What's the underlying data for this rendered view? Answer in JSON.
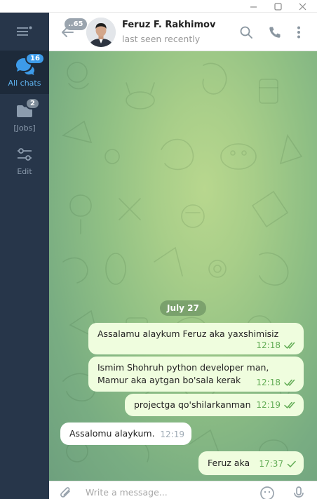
{
  "window": {
    "controls": [
      {
        "name": "minimize-button",
        "icon": "minimize-icon"
      },
      {
        "name": "maximize-button",
        "icon": "maximize-icon"
      },
      {
        "name": "close-button",
        "icon": "close-icon"
      }
    ]
  },
  "sidebar": {
    "menu_icon": "hamburger-menu-icon",
    "folders": [
      {
        "label": "All chats",
        "badge": "16",
        "icon": "chats-icon",
        "active": true
      },
      {
        "label": "[Jobs]",
        "badge": "2",
        "icon": "folder-icon",
        "active": false
      },
      {
        "label": "Edit",
        "icon": "sliders-icon",
        "active": false
      }
    ]
  },
  "header": {
    "back_badge": "..65",
    "name": "Feruz F. Rakhimov",
    "status": "last seen recently",
    "icons": [
      "search-icon",
      "phone-icon",
      "more-vertical-icon"
    ]
  },
  "chat": {
    "date_separator": "July 27",
    "messages": [
      {
        "direction": "out",
        "text": "Assalamu alaykum Feruz aka yaxshimisiz",
        "time": "12:18",
        "status": "read"
      },
      {
        "direction": "out",
        "text": "Ismim Shohruh python developer man,\nMamur aka aytgan bo'sala kerak",
        "time": "12:18",
        "status": "read"
      },
      {
        "direction": "out",
        "text": "projectga qo'shilarkanman",
        "time": "12:19",
        "status": "read"
      },
      {
        "direction": "in",
        "text": "Assalomu alaykum.",
        "time": "12:19"
      },
      {
        "direction": "out",
        "text": "Feruz aka",
        "time": "17:37",
        "status": "sent"
      }
    ]
  },
  "composer": {
    "placeholder": "Write a message...",
    "icons": [
      "attach-icon",
      "emoji-icon",
      "microphone-icon"
    ]
  },
  "colors": {
    "sidebar_bg": "#27364a",
    "sidebar_active_bg": "#1d2a3a",
    "accent_blue": "#3d9be9",
    "outgoing_bubble": "#effdde",
    "incoming_bubble": "#ffffff",
    "check_green": "#62ac55",
    "chat_bg_light": "#b8d78e",
    "chat_bg_dark": "#6ea07e"
  }
}
